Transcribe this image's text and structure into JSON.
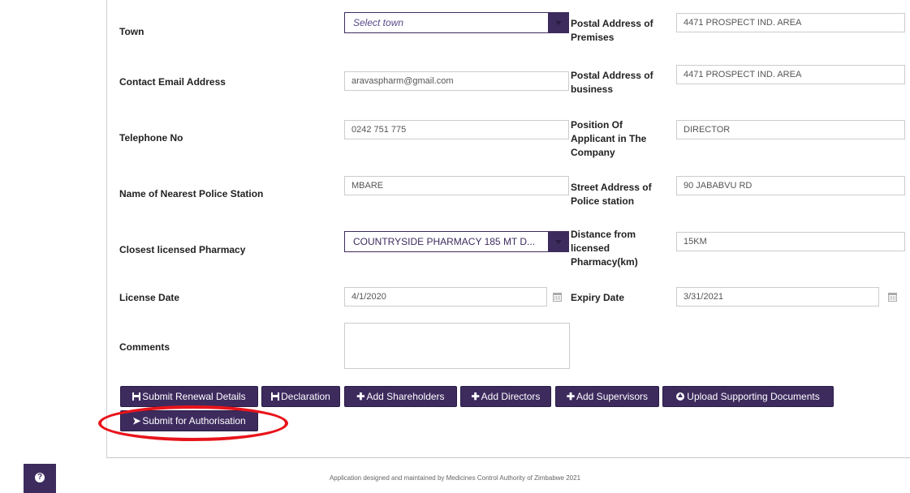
{
  "form": {
    "town": {
      "label": "Town",
      "placeholder": "Select town"
    },
    "postal_premises": {
      "label": "Postal Address of Premises",
      "value": "4471 PROSPECT IND. AREA"
    },
    "email": {
      "label": "Contact Email Address",
      "value": "aravaspharm@gmail.com"
    },
    "postal_business": {
      "label": "Postal Address of business",
      "value": "4471 PROSPECT IND. AREA"
    },
    "telephone": {
      "label": "Telephone No",
      "value": "0242 751 775"
    },
    "position": {
      "label": "Position Of Applicant in The Company",
      "value": "DIRECTOR"
    },
    "police_station": {
      "label": "Name of Nearest Police Station",
      "value": "MBARE"
    },
    "police_address": {
      "label": "Street Address of Police station",
      "value": "90 JABABVU RD"
    },
    "pharmacy": {
      "label": "Closest licensed Pharmacy",
      "value": "COUNTRYSIDE PHARMACY 185 MT D..."
    },
    "distance": {
      "label": "Distance from licensed Pharmacy(km)",
      "value": "15KM"
    },
    "license_date": {
      "label": "License Date",
      "value": "4/1/2020"
    },
    "expiry_date": {
      "label": "Expiry Date",
      "value": "3/31/2021"
    },
    "comments": {
      "label": "Comments",
      "value": ""
    }
  },
  "buttons": {
    "submit_renewal": "Submit Renewal Details",
    "declaration": "Declaration",
    "add_shareholders": "Add Shareholders",
    "add_directors": "Add Directors",
    "add_supervisors": "Add Supervisors",
    "upload_docs": "Upload Supporting Documents",
    "submit_auth": "Submit for Authorisation"
  },
  "footer": "Application designed and maintained by Medicines Control Authority of Zimbabwe 2021",
  "colors": {
    "accent": "#3d2b5e",
    "highlight": "#e8141b"
  },
  "icons": {
    "save": "save-icon",
    "plus": "plus-icon",
    "upload": "upload-icon",
    "send": "send-icon",
    "calendar": "calendar-icon",
    "help": "help-icon"
  }
}
